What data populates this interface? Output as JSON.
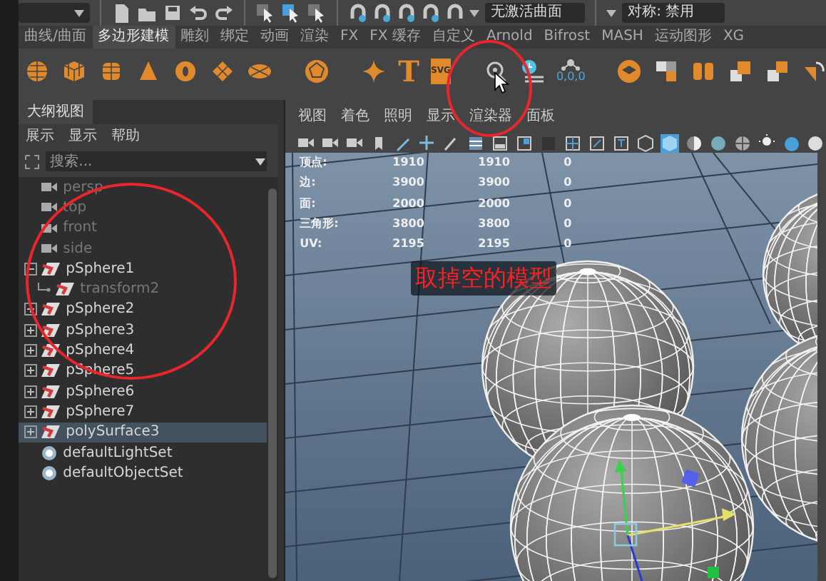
{
  "top_toolbar": {
    "curve_field": {
      "value": "无激活曲面"
    },
    "symmetry_field": {
      "value": "对称: 禁用"
    }
  },
  "shelf_tabs": [
    {
      "label": "曲线/曲面",
      "selected": false
    },
    {
      "label": "多边形建模",
      "selected": true
    },
    {
      "label": "雕刻",
      "selected": false
    },
    {
      "label": "绑定",
      "selected": false
    },
    {
      "label": "动画",
      "selected": false
    },
    {
      "label": "渲染",
      "selected": false
    },
    {
      "label": "FX",
      "selected": false
    },
    {
      "label": "FX 缓存",
      "selected": false
    },
    {
      "label": "自定义",
      "selected": false
    },
    {
      "label": "Arnold",
      "selected": false
    },
    {
      "label": "Bifrost",
      "selected": false
    },
    {
      "label": "MASH",
      "selected": false
    },
    {
      "label": "运动图形",
      "selected": false
    },
    {
      "label": "XG",
      "selected": false
    }
  ],
  "shelf": {
    "text_tool": "T",
    "svg_tool": "SVG",
    "pivot_readout": "0,0,0"
  },
  "outliner": {
    "title": "大纲视图",
    "menu": [
      "展示",
      "显示",
      "帮助"
    ],
    "search": {
      "placeholder": "搜索..."
    },
    "items": [
      {
        "label": "persp",
        "kind": "camera",
        "dimmed": true,
        "selected": false
      },
      {
        "label": "top",
        "kind": "camera",
        "dimmed": true,
        "selected": false
      },
      {
        "label": "front",
        "kind": "camera",
        "dimmed": true,
        "selected": false
      },
      {
        "label": "side",
        "kind": "camera",
        "dimmed": true,
        "selected": false
      },
      {
        "label": "pSphere1",
        "kind": "mesh",
        "dimmed": false,
        "selected": false,
        "expanded": true,
        "children": [
          {
            "label": "transform2",
            "kind": "mesh",
            "dimmed": true,
            "selected": false
          }
        ]
      },
      {
        "label": "pSphere2",
        "kind": "mesh",
        "dimmed": false,
        "selected": false,
        "expanded": false
      },
      {
        "label": "pSphere3",
        "kind": "mesh",
        "dimmed": false,
        "selected": false,
        "expanded": false
      },
      {
        "label": "pSphere4",
        "kind": "mesh",
        "dimmed": false,
        "selected": false,
        "expanded": false
      },
      {
        "label": "pSphere5",
        "kind": "mesh",
        "dimmed": false,
        "selected": false,
        "expanded": false
      },
      {
        "label": "pSphere6",
        "kind": "mesh",
        "dimmed": false,
        "selected": false,
        "expanded": false
      },
      {
        "label": "pSphere7",
        "kind": "mesh",
        "dimmed": false,
        "selected": false,
        "expanded": false
      },
      {
        "label": "polySurface3",
        "kind": "mesh",
        "dimmed": false,
        "selected": true,
        "expanded": false
      },
      {
        "label": "defaultLightSet",
        "kind": "set",
        "dimmed": false,
        "selected": false
      },
      {
        "label": "defaultObjectSet",
        "kind": "set",
        "dimmed": false,
        "selected": false
      }
    ]
  },
  "viewport": {
    "menu": [
      "视图",
      "着色",
      "照明",
      "显示",
      "渲染器",
      "面板"
    ],
    "hud": [
      {
        "label": "顶点:",
        "values": [
          "1910",
          "1910",
          "0"
        ]
      },
      {
        "label": "边:",
        "values": [
          "3900",
          "3900",
          "0"
        ]
      },
      {
        "label": "面:",
        "values": [
          "2000",
          "2000",
          "0"
        ]
      },
      {
        "label": "三角形:",
        "values": [
          "3800",
          "3800",
          "0"
        ]
      },
      {
        "label": "UV:",
        "values": [
          "2195",
          "2195",
          "0"
        ]
      }
    ]
  },
  "annotation": {
    "note": "取掉空的模型"
  }
}
